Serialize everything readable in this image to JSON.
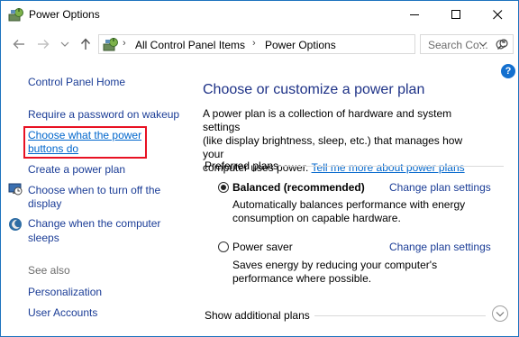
{
  "window": {
    "title": "Power Options"
  },
  "address": {
    "crumbs": [
      "All Control Panel Items",
      "Power Options"
    ],
    "search_placeholder": "Search Co..."
  },
  "help_label": "?",
  "sidebar": {
    "home": "Control Panel Home",
    "items": [
      "Require a password on wakeup",
      "Choose what the power",
      "buttons do",
      "Create a power plan",
      "Choose when to turn off the",
      "display",
      "Change when the computer",
      "sleeps"
    ],
    "see_also_title": "See also",
    "see_also": [
      "Personalization",
      "User Accounts"
    ]
  },
  "main": {
    "heading": "Choose or customize a power plan",
    "intro_line1": "A power plan is a collection of hardware and system settings",
    "intro_line2": "(like display brightness, sleep, etc.) that manages how your",
    "intro_line3": "computer uses power.",
    "intro_link": "Tell me more about power plans",
    "preferred_label": "Preferred plans",
    "plans": [
      {
        "name": "Balanced (recommended)",
        "selected": true,
        "desc1": "Automatically balances performance with energy",
        "desc2": "consumption on capable hardware.",
        "link": "Change plan settings"
      },
      {
        "name": "Power saver",
        "selected": false,
        "desc1": "Saves energy by reducing your computer's",
        "desc2": "performance where possible.",
        "link": "Change plan settings"
      }
    ],
    "show_additional": "Show additional plans"
  }
}
